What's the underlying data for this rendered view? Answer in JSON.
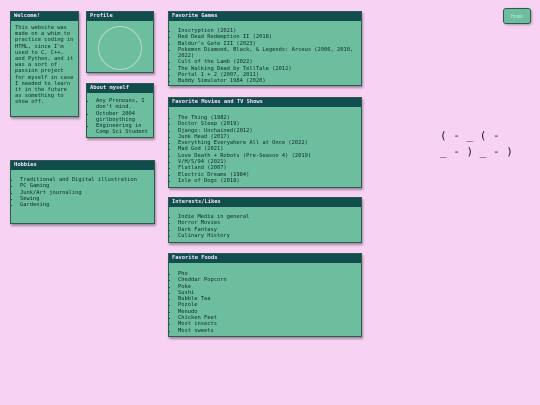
{
  "home_button": "Home",
  "welcome": {
    "title": "Welcome!",
    "text": "This website was made on a whim to practice coding in HTML, since I'm used to C, C++, and Python, and it was a sort of passion project for myself in case I needed to learn it in the future as something to show off."
  },
  "profile": {
    "title": "Profile"
  },
  "about": {
    "title": "About myself",
    "items": [
      "Any Pronouns, I don't mind.",
      "October 2004 girlboything",
      "Engineering in Comp Sci Student"
    ]
  },
  "hobbies": {
    "title": "Hobbies",
    "items": [
      "Traditional and Digital illustration",
      "PC Gaming",
      "Junk/Art journaling",
      "Sewing",
      "Gardening"
    ]
  },
  "games": {
    "title": "Favorite Games",
    "items": [
      "Inscryption (2021)",
      "Red Dead Redemption II (2018)",
      "Baldur's Gate III (2023)",
      "Pokemon Diamond, Black, & Legends: Arceus (2006, 2010, 2022)",
      "Cult of the Lamb (2022)",
      "The Walking Dead by TellTale (2012)",
      "Portal 1 + 2 (2007, 2011)",
      "Buddy Simulator 1984 (2020)"
    ]
  },
  "movies": {
    "title": "Favorite Movies and TV Shows",
    "items": [
      "The Thing (1982)",
      "Doctor Sleep (2019)",
      "Django: Unchained(2012)",
      "Junk Head (2017)",
      "Everything Everywhere All at Once (2022)",
      "Mad God (2021)",
      "Love Death + Robots (Pre-Season 4) (2019)",
      "V/H/S/94 (2021)",
      "Flatland (2007)",
      "Electric Dreams (1984)",
      "Isle of Dogs (2018)"
    ]
  },
  "interests": {
    "title": "Interests/Likes",
    "items": [
      "Indie Media in general",
      "Horror Movies",
      "Dark Fantasy",
      "Culinary History"
    ]
  },
  "foods": {
    "title": "Favorite Foods",
    "items": [
      "Pho",
      "Cheddar Popcorn",
      "Poke",
      "Sushi",
      "Bubble Tea",
      "Pozole",
      "Menudo",
      "Chicken Feet",
      "Most insects",
      "Most sweets"
    ]
  },
  "ascii_art": "( - _ ( -\n_ - ) _ - )"
}
